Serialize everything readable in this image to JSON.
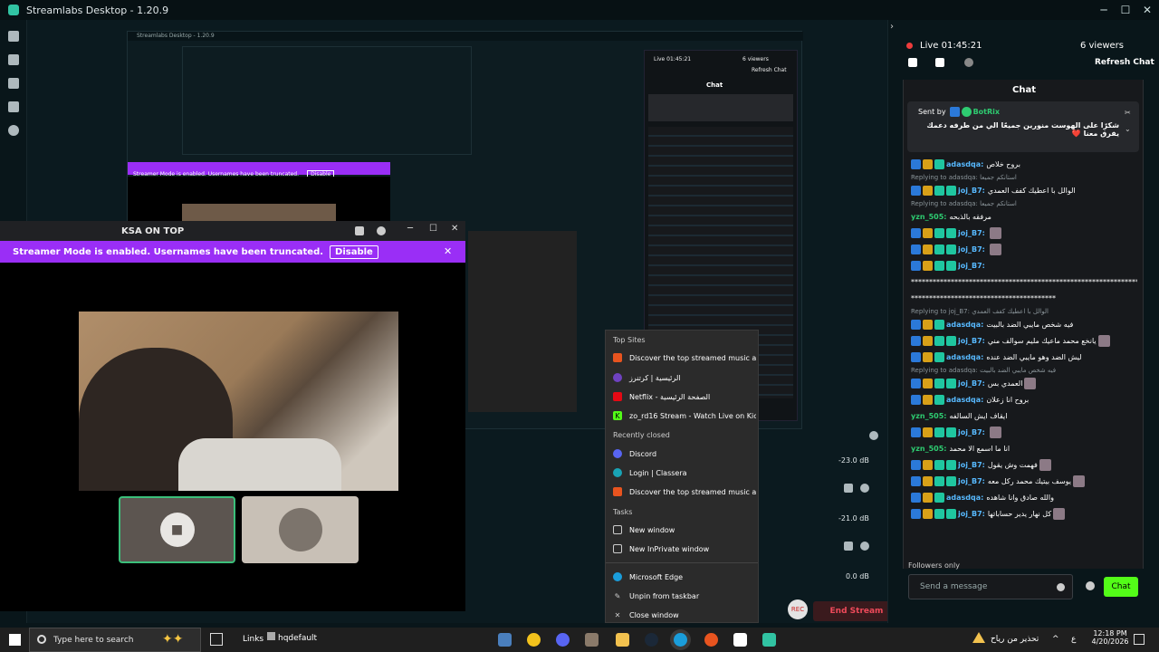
{
  "window": {
    "title": "Streamlabs Desktop - 1.20.9"
  },
  "nested": {
    "title": "Streamlabs Desktop - 1.20.9",
    "ksa_title": "KSA ON TOP",
    "banner": "Streamer Mode is enabled. Usernames have been truncated.",
    "disable": "Disable",
    "chat_label": "Chat",
    "live": "Live 01:45:21",
    "viewers": "6 viewers",
    "refresh": "Refresh Chat"
  },
  "ksa": {
    "title": "KSA ON TOP"
  },
  "banner": {
    "message": "Streamer Mode is enabled. Usernames have been truncated.",
    "disable_label": "Disable",
    "close": "✕"
  },
  "mixer": {
    "db1": "-23.0 dB",
    "db2": "-21.0 dB",
    "db3": "0.0 dB"
  },
  "end_stream": "End Stream",
  "jumplist": {
    "top_sites_label": "Top Sites",
    "top_sites": [
      "Discover the top streamed music and...",
      "الرئيسية | كرتنرز",
      "Netflix - الصفحة الرئيسية",
      "zo_rd16 Stream - Watch Live on Kick"
    ],
    "recently_closed_label": "Recently closed",
    "recently_closed": [
      "Discord",
      "Login | Classera",
      "Discover the top streamed music and..."
    ],
    "tasks_label": "Tasks",
    "tasks": [
      "New window",
      "New InPrivate window"
    ],
    "app_items": [
      "Microsoft Edge",
      "Unpin from taskbar",
      "Close window"
    ]
  },
  "rightpanel": {
    "live_time": "Live 01:45:21",
    "viewers": "6 viewers",
    "refresh_chat": "Refresh Chat",
    "chat_title": "Chat",
    "pinned": {
      "sent_by": "Sent by",
      "bot": "BotRix",
      "text": "شكرًا على الهوست منورين جميعًا الي من طرفه دعمك يفرق معنا ❤️"
    },
    "messages": [
      {
        "type": "msg",
        "badges": 3,
        "user": "adasdqa:",
        "text": "بروح خلاص",
        "color": "blue"
      },
      {
        "type": "reply",
        "text": "Replying to adasdqa: استانكم جميعا"
      },
      {
        "type": "msg",
        "badges": 4,
        "user": "joj_B7:",
        "text": "الوالل با اعطيك كفف العمدي",
        "color": "blue"
      },
      {
        "type": "reply",
        "text": "Replying to adasdqa: استانكم جميعا"
      },
      {
        "type": "msg",
        "badges": 0,
        "user": "yzn_505:",
        "text": "مرفقه بالذبحه",
        "color": "green"
      },
      {
        "type": "msg",
        "badges": 4,
        "user": "joj_B7:",
        "text": "",
        "color": "blue",
        "avatar": true
      },
      {
        "type": "msg",
        "badges": 4,
        "user": "joj_B7:",
        "text": "",
        "color": "blue",
        "avatar": true
      },
      {
        "type": "msg",
        "badges": 4,
        "user": "joj_B7:",
        "text": "",
        "color": "blue"
      },
      {
        "type": "plain",
        "text": "***************************************************************"
      },
      {
        "type": "plain",
        "text": "****************************************"
      },
      {
        "type": "reply",
        "text": "Replying to joj_B7: الوالل با اعطيك كفف العمدي"
      },
      {
        "type": "msg",
        "badges": 3,
        "user": "adasdqa:",
        "text": "فيه شخص مايبي الضد بالبيت",
        "color": "blue"
      },
      {
        "type": "msg",
        "badges": 4,
        "user": "joj_B7:",
        "text": "يانخع محمد ماعيك مليم سوالف مني",
        "color": "blue",
        "avatar": true
      },
      {
        "type": "msg",
        "badges": 3,
        "user": "adasdqa:",
        "text": "ليش الضد وهو مايبي الضد عنده",
        "color": "blue"
      },
      {
        "type": "reply",
        "text": "Replying to adasdqa: فيه شخص مايبي الضد بالبيت"
      },
      {
        "type": "msg",
        "badges": 4,
        "user": "joj_B7:",
        "text": "العمدي بس",
        "color": "blue",
        "avatar": true
      },
      {
        "type": "msg",
        "badges": 3,
        "user": "adasdqa:",
        "text": "بروح انا زعلان",
        "color": "blue"
      },
      {
        "type": "msg",
        "badges": 0,
        "user": "yzn_505:",
        "text": "ايقاف ايش السالفه",
        "color": "green"
      },
      {
        "type": "msg",
        "badges": 4,
        "user": "joj_B7:",
        "text": "",
        "color": "blue",
        "avatar": true
      },
      {
        "type": "msg",
        "badges": 0,
        "user": "yzn_505:",
        "text": "انا ما اسمع الا محمد",
        "color": "green"
      },
      {
        "type": "msg",
        "badges": 4,
        "user": "joj_B7:",
        "text": "فهمت وش يقول",
        "color": "blue",
        "avatar": true
      },
      {
        "type": "msg",
        "badges": 4,
        "user": "joj_B7:",
        "text": "يوسف بيتيك محمد ركل معه",
        "color": "blue",
        "avatar": true
      },
      {
        "type": "msg",
        "badges": 3,
        "user": "adasdqa:",
        "text": "والله صادق وانا شاهده",
        "color": "blue"
      },
      {
        "type": "msg",
        "badges": 4,
        "user": "joj_B7:",
        "text": "كل نهار يدير حساباتها",
        "color": "blue",
        "avatar": true
      }
    ],
    "followers_only": "Followers only",
    "send_placeholder": "Send a message",
    "chat_button": "Chat"
  },
  "taskbar": {
    "search_placeholder": "Type here to search",
    "links": "Links",
    "hqdefault": "hqdefault",
    "weather": "تحذير من رياح",
    "lang": "ع",
    "time": "12:18 PM",
    "date": "4/20/2026"
  }
}
